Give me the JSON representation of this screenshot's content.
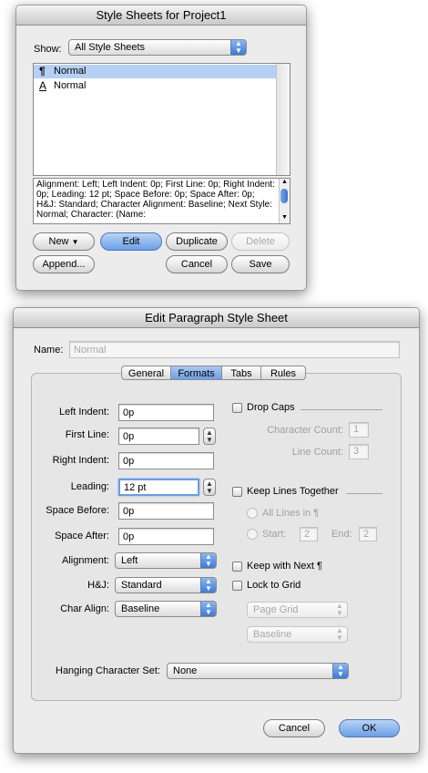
{
  "style_sheets_window": {
    "title": "Style Sheets for Project1",
    "show_label": "Show:",
    "show_value": "All Style Sheets",
    "list_items": [
      {
        "icon": "paragraph-style-icon",
        "glyph": "¶",
        "label": "Normal",
        "selected": true
      },
      {
        "icon": "character-style-icon",
        "glyph": "A",
        "label": "Normal",
        "selected": false
      }
    ],
    "description": "Alignment: Left;   Left Indent: 0p;   First Line: 0p;   Right Indent: 0p;   Leading: 12 pt;   Space Before: 0p;   Space After: 0p;   H&J: Standard;   Character Alignment: Baseline;   Next Style: Normal;   Character: (Name:",
    "buttons": {
      "new": "New",
      "edit": "Edit",
      "duplicate": "Duplicate",
      "delete": "Delete",
      "append": "Append...",
      "cancel": "Cancel",
      "save": "Save"
    }
  },
  "edit_dialog": {
    "title": "Edit Paragraph Style Sheet",
    "name_label": "Name:",
    "name_value": "Normal",
    "tabs": [
      "General",
      "Formats",
      "Tabs",
      "Rules"
    ],
    "active_tab": "Formats",
    "fields": {
      "left_indent": {
        "label": "Left Indent:",
        "value": "0p"
      },
      "first_line": {
        "label": "First Line:",
        "value": "0p"
      },
      "right_indent": {
        "label": "Right Indent:",
        "value": "0p"
      },
      "leading": {
        "label": "Leading:",
        "value": "12 pt"
      },
      "space_before": {
        "label": "Space Before:",
        "value": "0p"
      },
      "space_after": {
        "label": "Space After:",
        "value": "0p"
      },
      "alignment": {
        "label": "Alignment:",
        "value": "Left"
      },
      "hj": {
        "label": "H&J:",
        "value": "Standard"
      },
      "char_align": {
        "label": "Char Align:",
        "value": "Baseline"
      }
    },
    "drop_caps": {
      "label": "Drop Caps",
      "character_count_label": "Character Count:",
      "character_count_value": "1",
      "line_count_label": "Line Count:",
      "line_count_value": "3"
    },
    "keep_lines": {
      "label": "Keep Lines Together",
      "all_lines_label": "All Lines in ¶",
      "start_label": "Start:",
      "start_value": "2",
      "end_label": "End:",
      "end_value": "2"
    },
    "keep_with_next": "Keep with Next ¶",
    "lock_to_grid": {
      "label": "Lock to Grid",
      "page_grid": "Page Grid",
      "baseline": "Baseline"
    },
    "hanging_character_set": {
      "label": "Hanging Character Set:",
      "value": "None"
    },
    "buttons": {
      "cancel": "Cancel",
      "ok": "OK"
    }
  },
  "colors": {
    "selection": "#b5d0f4",
    "default_button": "#6c9fe6"
  }
}
